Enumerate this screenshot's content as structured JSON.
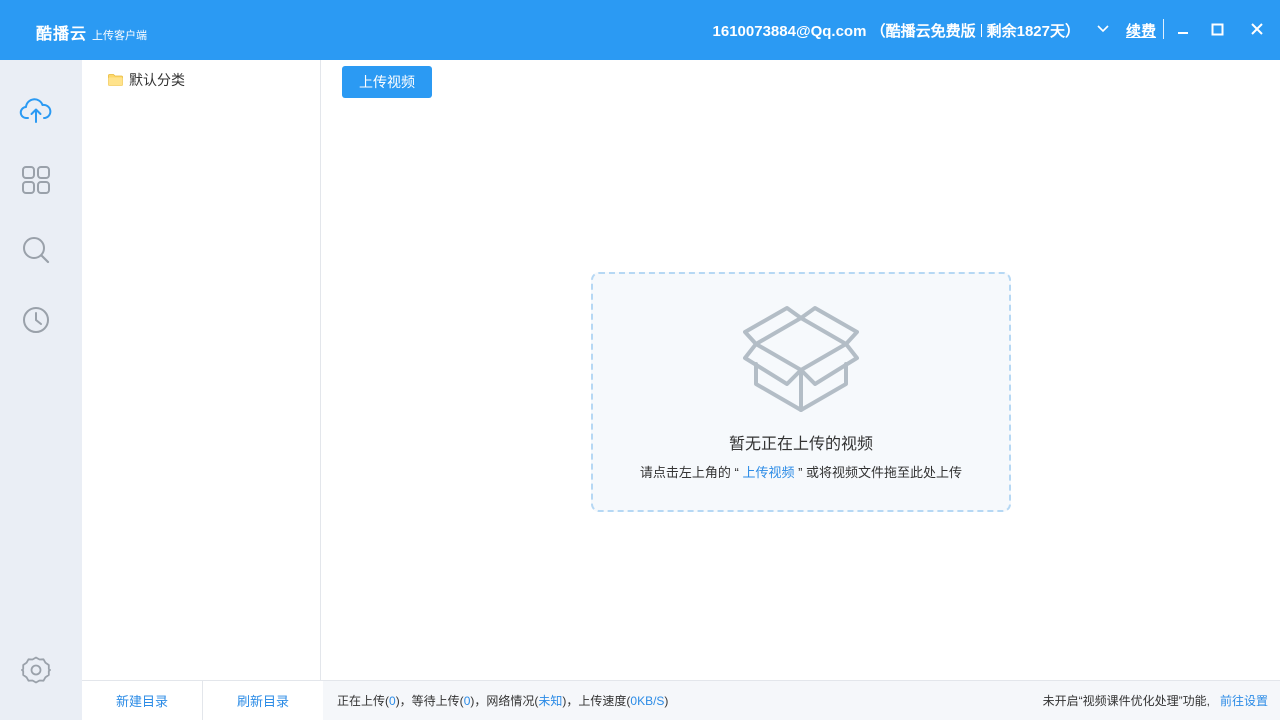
{
  "titlebar": {
    "app_name": "酷播云",
    "app_subtitle": "上传客户端",
    "account_email": "1610073884@Qq.com",
    "open_paren": "（",
    "plan": "酷播云免费版",
    "remaining": "剩余1827天",
    "close_paren": "）",
    "renew_label": "续费",
    "bg_color": "#2b9af3"
  },
  "rail": {
    "items": [
      {
        "name": "upload",
        "icon": "cloud-upload-icon"
      },
      {
        "name": "grid",
        "icon": "grid-icon"
      },
      {
        "name": "search",
        "icon": "search-icon"
      },
      {
        "name": "history",
        "icon": "clock-icon"
      }
    ],
    "settings_icon": "gear-icon"
  },
  "folders": {
    "items": [
      {
        "label": "默认分类",
        "icon": "folder-icon"
      }
    ],
    "new_folder_label": "新建目录",
    "refresh_label": "刷新目录"
  },
  "main": {
    "upload_button_label": "上传视频",
    "empty_title": "暂无正在上传的视频",
    "hint_prefix": "请点击左上角的 “ ",
    "hint_link": "上传视频",
    "hint_suffix": " ” 或将视频文件拖至此处上传",
    "empty_icon": "open-box-icon"
  },
  "status": {
    "uploading_label": "正在上传(",
    "uploading_count": "0",
    "waiting_label": ")，等待上传(",
    "waiting_count": "0",
    "network_label": ")，网络情况(",
    "network_value": "未知",
    "speed_label": ")，上传速度(",
    "speed_value": "0KB/S",
    "speed_close": ")",
    "feature_notice": "未开启“视频课件优化处理”功能,",
    "settings_link": "前往设置"
  },
  "colors": {
    "accent": "#2b9af3",
    "link": "#2b8be6",
    "rail_bg": "#eaeef5",
    "icon_gray": "#9aa1aa"
  }
}
